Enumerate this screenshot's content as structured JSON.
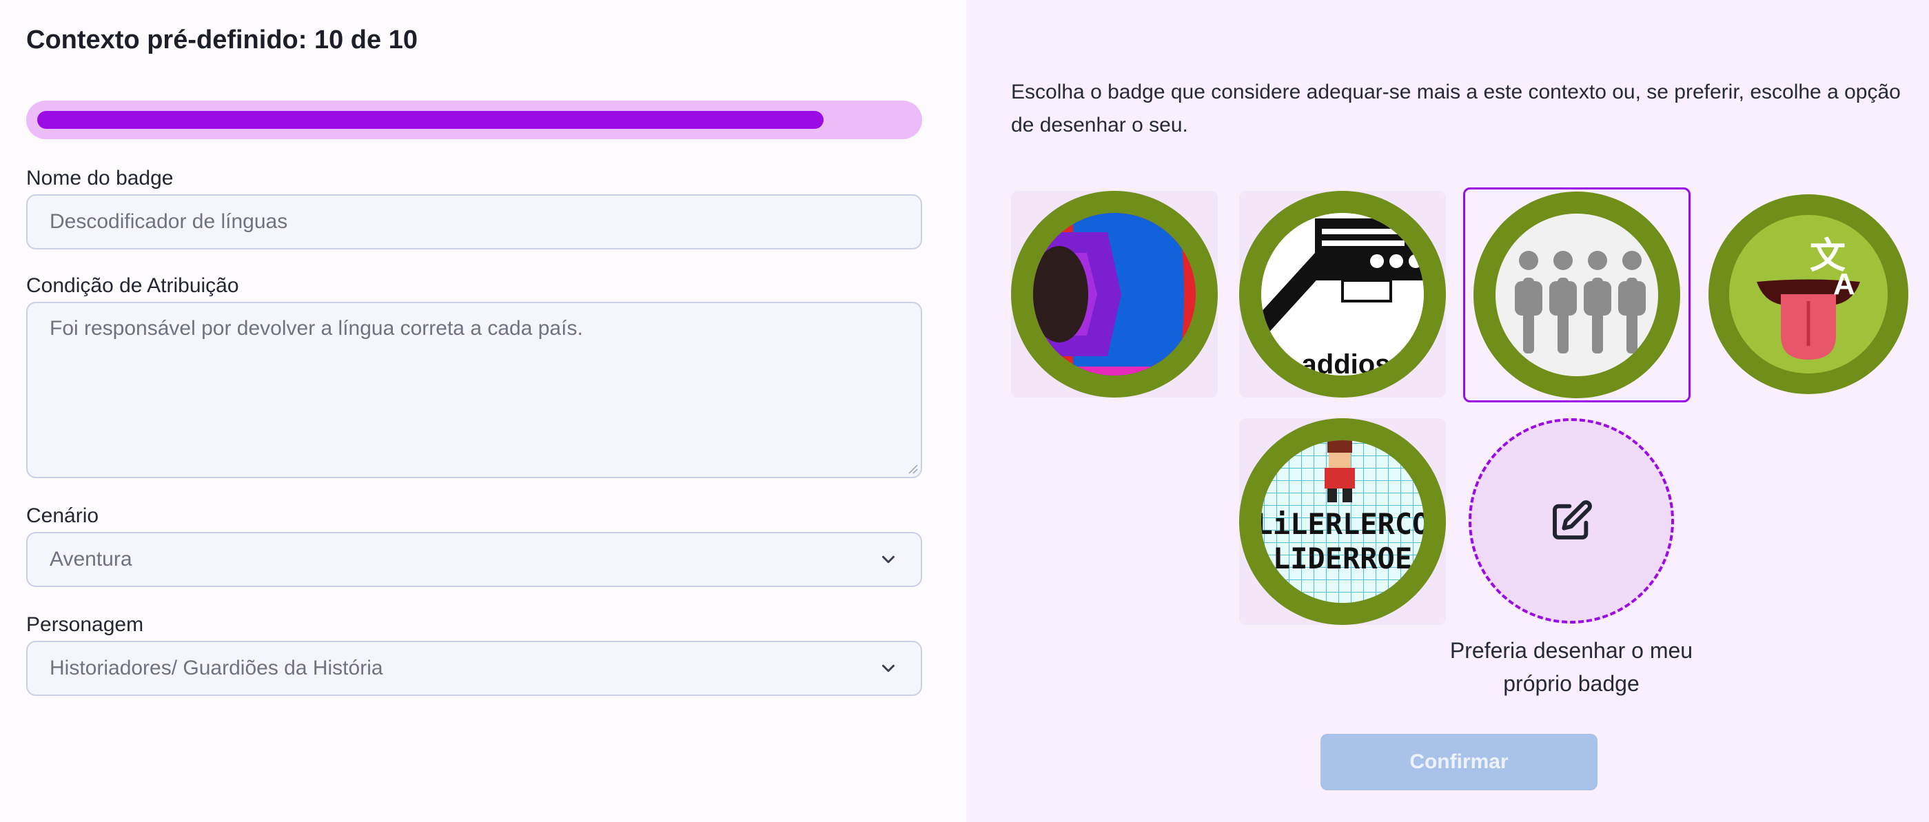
{
  "form": {
    "title": "Contexto pré-definido: 10 de 10",
    "progress_fraction": 0.9,
    "badge_name": {
      "label": "Nome do badge",
      "placeholder": "Descodificador de línguas"
    },
    "condition": {
      "label": "Condição de Atribuição",
      "placeholder": "Foi responsável por devolver a língua correta a cada país."
    },
    "scenario": {
      "label": "Cenário",
      "value": "Aventura"
    },
    "character": {
      "label": "Personagem",
      "value": "Historiadores/ Guardiões da História"
    }
  },
  "badge_picker": {
    "instructions": "Escolha o badge que considere adequar-se mais a este contexto ou, se preferir, escolhe a opção de desenhar o seu.",
    "options": [
      {
        "name": "eye-badge",
        "selected": false
      },
      {
        "name": "machine-badge",
        "selected": false,
        "partial_text": "addios"
      },
      {
        "name": "statues-badge",
        "selected": true
      },
      {
        "name": "translate-tongue-badge",
        "selected": false,
        "icon": "translate-icon"
      },
      {
        "name": "pixel-art-badge",
        "selected": false,
        "text_line1": "LiLERLERCO",
        "text_line2": "LIDERROE"
      }
    ],
    "draw_own_label": "Preferia desenhar o meu próprio badge",
    "draw_icon": "edit-icon",
    "confirm_label": "Confirmar"
  },
  "colors": {
    "accent": "#9a0be6",
    "badge_ring": "#6f8f1a",
    "confirm_disabled": "#a9c2ea"
  }
}
